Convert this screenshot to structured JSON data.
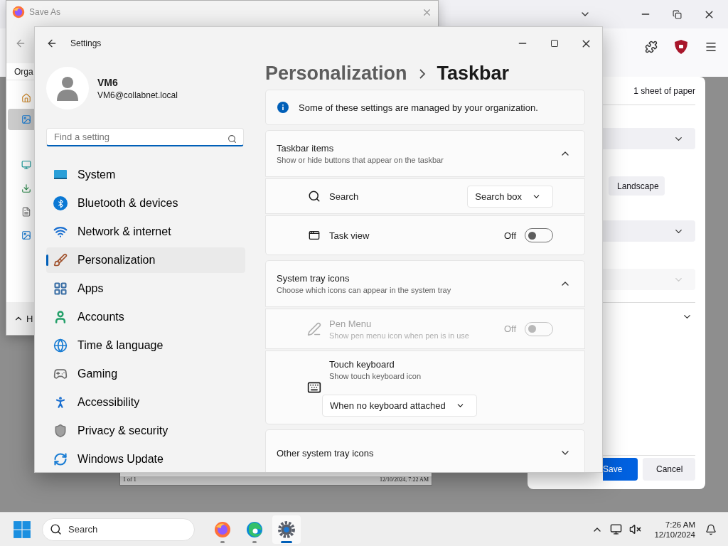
{
  "browser": {
    "print_preview": {
      "footer_left": "1 of 1",
      "footer_right": "12/10/2024, 7:22 AM"
    },
    "print_dialog": {
      "sheet_count": "1 sheet of paper",
      "orientation": "Landscape",
      "selects": [
        {
          "disabled": false
        },
        {
          "disabled": false
        },
        {
          "disabled": true
        }
      ],
      "more_settings": {
        "expanded": false
      },
      "buttons": [
        {
          "label": "Save",
          "kind": "primary"
        },
        {
          "label": "Cancel",
          "kind": "secondary"
        }
      ]
    }
  },
  "save_as": {
    "title": "Save As",
    "command_bar": "Orga",
    "nav_items": [
      {
        "kind": "home",
        "selected": false
      },
      {
        "kind": "gallery",
        "selected": true
      },
      {
        "kind": "desktop",
        "selected": false
      },
      {
        "kind": "downloads",
        "selected": false
      },
      {
        "kind": "documents",
        "selected": false
      },
      {
        "kind": "pictures",
        "selected": false
      }
    ],
    "folders_toggle": "H"
  },
  "settings": {
    "title": "Settings",
    "user": {
      "name": "VM6",
      "email": "VM6@collabnet.local"
    },
    "search": {
      "placeholder": "Find a setting"
    },
    "nav": [
      {
        "label": "System",
        "kind": "system",
        "selected": false
      },
      {
        "label": "Bluetooth & devices",
        "kind": "bluetooth",
        "selected": false
      },
      {
        "label": "Network & internet",
        "kind": "network",
        "selected": false
      },
      {
        "label": "Personalization",
        "kind": "personalization",
        "selected": true
      },
      {
        "label": "Apps",
        "kind": "apps",
        "selected": false
      },
      {
        "label": "Accounts",
        "kind": "accounts",
        "selected": false
      },
      {
        "label": "Time & language",
        "kind": "time",
        "selected": false
      },
      {
        "label": "Gaming",
        "kind": "gaming",
        "selected": false
      },
      {
        "label": "Accessibility",
        "kind": "accessibility",
        "selected": false
      },
      {
        "label": "Privacy & security",
        "kind": "privacy",
        "selected": false
      },
      {
        "label": "Windows Update",
        "kind": "update",
        "selected": false
      }
    ],
    "breadcrumb": {
      "parent": "Personalization",
      "current": "Taskbar"
    },
    "notice": "Some of these settings are managed by your organization.",
    "sections": [
      {
        "title": "Taskbar items",
        "subtitle": "Show or hide buttons that appear on the taskbar",
        "expanded": true,
        "rows": [
          {
            "kind": "dropdown",
            "label": "Search",
            "value": "Search box",
            "disabled": false
          },
          {
            "kind": "toggle",
            "label": "Task view",
            "state_label": "Off",
            "on": false,
            "disabled": false
          }
        ]
      },
      {
        "title": "System tray icons",
        "subtitle": "Choose which icons can appear in the system tray",
        "expanded": true,
        "rows": [
          {
            "kind": "toggle",
            "label": "Pen Menu",
            "description": "Show pen menu icon when pen is in use",
            "state_label": "Off",
            "on": false,
            "disabled": true
          },
          {
            "kind": "stacked_dropdown",
            "label": "Touch keyboard",
            "description": "Show touch keyboard icon",
            "value": "When no keyboard attached",
            "disabled": false
          }
        ]
      },
      {
        "title": "Other system tray icons",
        "expanded": false
      }
    ]
  },
  "taskbar": {
    "search_placeholder": "Search",
    "apps": [
      {
        "kind": "firefox",
        "active": false
      },
      {
        "kind": "edge",
        "active": false
      },
      {
        "kind": "settings",
        "active": true
      }
    ],
    "time": "7:26 AM",
    "date": "12/10/2024"
  }
}
